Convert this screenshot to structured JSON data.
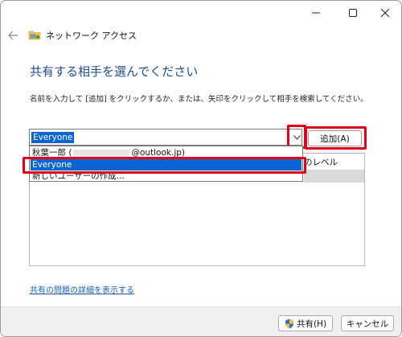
{
  "window": {
    "controls": {
      "minimize_icon": "minimize-icon",
      "maximize_icon": "maximize-icon",
      "close_icon": "close-icon"
    },
    "title": "ネットワーク アクセス"
  },
  "heading": "共有する相手を選んでください",
  "instruction": "名前を入力して [追加] をクリックするか、または、矢印をクリックして相手を検索してください。",
  "combo": {
    "value": "Everyone"
  },
  "add_button": "追加(A)",
  "dropdown": {
    "options": [
      {
        "prefix": "秋葉一郎 (",
        "suffix": "@outlook.jp)"
      },
      {
        "label": "Everyone"
      },
      {
        "label": "新しいユーザーの作成..."
      }
    ]
  },
  "list": {
    "permission_header_partial": "のレベル"
  },
  "link": "共有の問題の詳細を表示する",
  "footer": {
    "share_button": "共有(H)",
    "cancel_button": "キャンセル"
  },
  "colors": {
    "accent": "#0a64d2",
    "highlight_box": "#e0001b",
    "heading": "#1f4e8c",
    "link": "#1a5fb4"
  }
}
